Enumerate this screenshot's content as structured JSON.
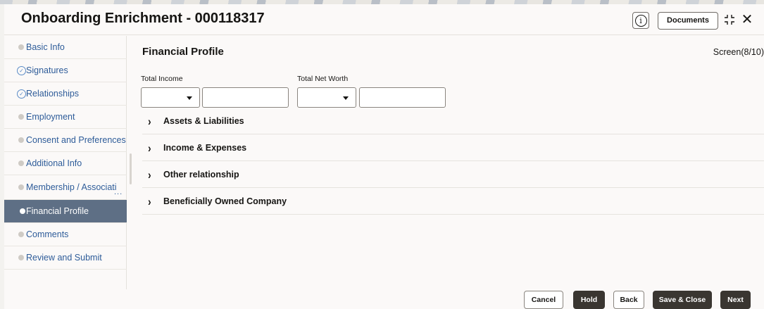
{
  "header": {
    "title": "Onboarding Enrichment - 000118317",
    "info_glyph": "i",
    "documents_label": "Documents",
    "expand_glyph": "⋰",
    "close_glyph": "✕"
  },
  "sidebar": {
    "items": [
      {
        "label": "Basic Info",
        "state": "pending"
      },
      {
        "label": "Signatures",
        "state": "done"
      },
      {
        "label": "Relationships",
        "state": "done"
      },
      {
        "label": "Employment",
        "state": "pending"
      },
      {
        "label": "Consent and Preferences",
        "state": "pending"
      },
      {
        "label": "Additional Info",
        "state": "pending"
      },
      {
        "label": "Membership / Associati",
        "state": "pending"
      },
      {
        "label": "Financial Profile",
        "state": "active"
      },
      {
        "label": "Comments",
        "state": "pending"
      },
      {
        "label": "Review and Submit",
        "state": "pending"
      }
    ],
    "truncation_marker": "..."
  },
  "main": {
    "section_title": "Financial Profile",
    "screen_count": "Screen(8/10)",
    "total_income_label": "Total Income",
    "total_income_currency": "",
    "total_income_value": "",
    "total_net_worth_label": "Total Net Worth",
    "total_net_worth_currency": "",
    "total_net_worth_value": "",
    "accordions": [
      "Assets & Liabilities",
      "Income & Expenses",
      "Other relationship",
      "Beneficially Owned Company"
    ]
  },
  "footer": {
    "cancel": "Cancel",
    "hold": "Hold",
    "back": "Back",
    "save_close": "Save & Close",
    "next": "Next"
  },
  "colors": {
    "active_nav_bg": "#5e6f85",
    "link_blue": "#2e5c99",
    "dark_button": "#3a3631"
  }
}
